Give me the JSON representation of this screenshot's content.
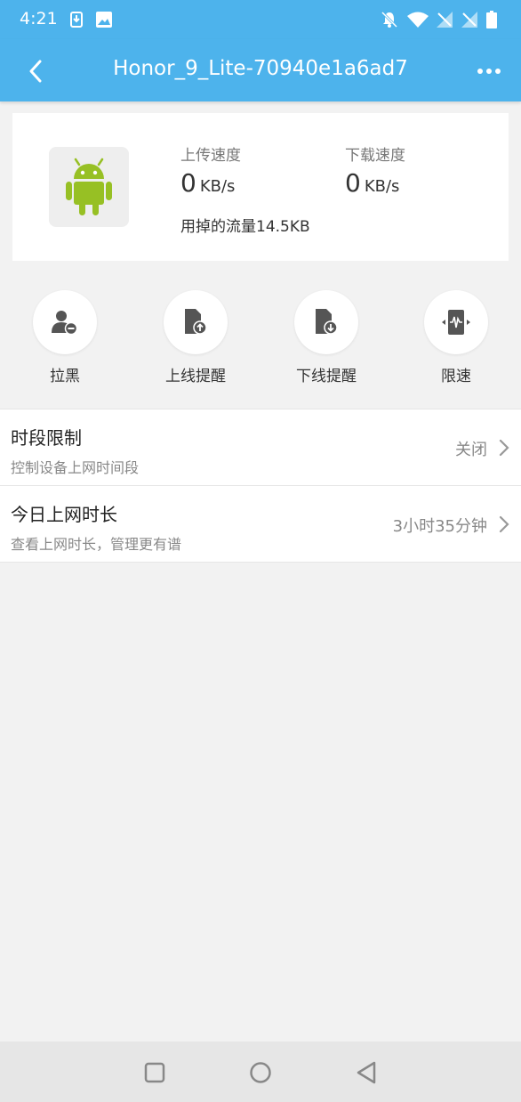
{
  "status_bar": {
    "time": "4:21",
    "left_icons": [
      "download-icon",
      "image-icon"
    ],
    "right_icons": [
      "bell-off-icon",
      "wifi-icon",
      "signal-off-icon",
      "signal-off-icon",
      "battery-icon"
    ]
  },
  "app_bar": {
    "title": "Honor_9_Lite-70940e1a6ad7",
    "back_icon": "chevron-left-icon",
    "more_icon": "more-dots-icon"
  },
  "device_card": {
    "icon": "android-icon",
    "upload_label": "上传速度",
    "upload_value": "0",
    "upload_unit": "KB/s",
    "download_label": "下载速度",
    "download_value": "0",
    "download_unit": "KB/s",
    "traffic_text": "用掉的流量14.5KB"
  },
  "actions": [
    {
      "label": "拉黑",
      "icon": "user-block-icon"
    },
    {
      "label": "上线提醒",
      "icon": "online-alert-icon"
    },
    {
      "label": "下线提醒",
      "icon": "offline-alert-icon"
    },
    {
      "label": "限速",
      "icon": "speed-limit-icon"
    }
  ],
  "settings": [
    {
      "title": "时段限制",
      "subtitle": "控制设备上网时间段",
      "value": "关闭"
    },
    {
      "title": "今日上网时长",
      "subtitle": "查看上网时长，管理更有谱",
      "value": "3小时35分钟"
    }
  ],
  "colors": {
    "accent": "#4db3ec",
    "android_green": "#97c024",
    "background": "#f2f2f2"
  },
  "nav_bar": [
    "recents-square-icon",
    "home-circle-icon",
    "back-triangle-icon"
  ]
}
